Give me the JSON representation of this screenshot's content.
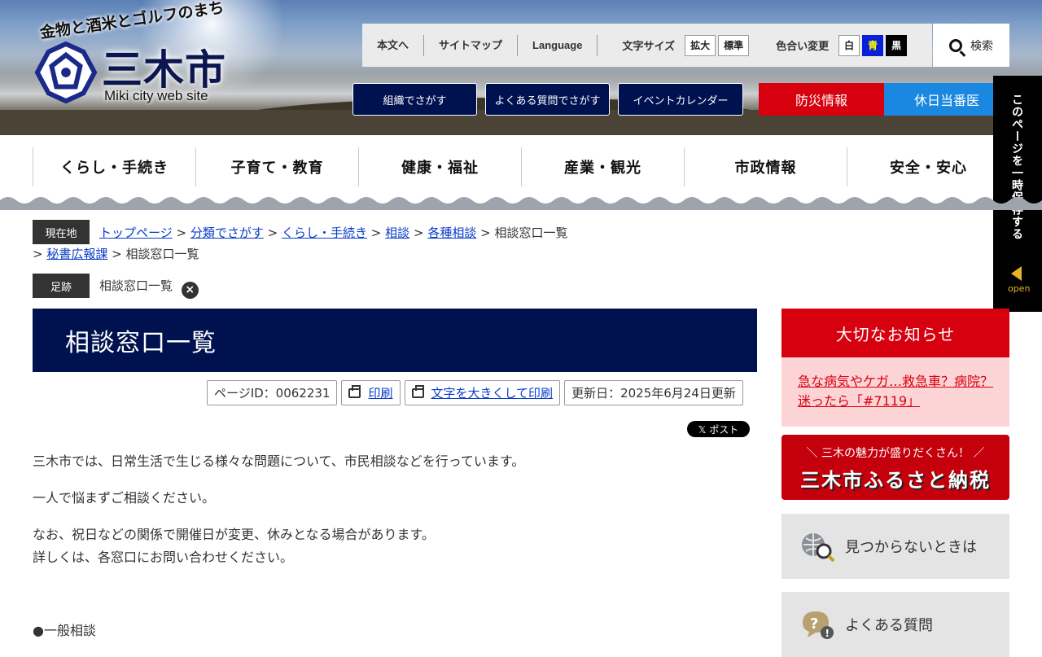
{
  "header": {
    "tagline": "金物と酒米とゴルフのまち",
    "city_name": "三木市",
    "site_subtitle": "Miki city web site",
    "util_links": [
      "本文へ",
      "サイトマップ",
      "Language"
    ],
    "font_size_label": "文字サイズ",
    "font_size_buttons": [
      "拡大",
      "標準"
    ],
    "color_label": "色合い変更",
    "color_buttons": [
      "白",
      "青",
      "黒"
    ],
    "search_label": "検索",
    "nav_buttons": [
      "組織でさがす",
      "よくある質問でさがす",
      "イベントカレンダー"
    ],
    "disaster_label": "防災情報",
    "holiday_label": "休日当番医"
  },
  "side_tab": {
    "text": "このページを一時保存する",
    "open_label": "open"
  },
  "global_nav": [
    "くらし・手続き",
    "子育て・教育",
    "健康・福祉",
    "産業・観光",
    "市政情報",
    "安全・安心"
  ],
  "breadcrumb": {
    "label": "現在地",
    "links1": [
      "トップページ",
      "分類でさがす",
      "くらし・手続き",
      "相談",
      "各種相談"
    ],
    "current1": "相談窓口一覧",
    "links2": [
      "秘書広報課"
    ],
    "current2": "相談窓口一覧",
    "sep": ">"
  },
  "history": {
    "label": "足跡",
    "item": "相談窓口一覧",
    "clear": "×"
  },
  "main": {
    "title": "相談窓口一覧",
    "page_id": "ページID：0062231",
    "print": "印刷",
    "print_large": "文字を大きくして印刷",
    "updated": "更新日：2025年6月24日更新",
    "post": "𝕏 ポスト",
    "para1": "三木市では、日常生活で生じる様々な問題について、市民相談などを行っています。",
    "para2": "一人で悩まずご相談ください。",
    "para3a": "なお、祝日などの関係で開催日が変更、休みとなる場合があります。",
    "para3b": "詳しくは、各窓口にお問い合わせください。",
    "section1": "●一般相談"
  },
  "sidebar": {
    "notice_title": "大切なお知らせ",
    "notice_link": "急な病気やケガ…救急車？病院？迷ったら「#7119」",
    "furusato_small": "＼ 三木の魅力が盛りだくさん！ ／",
    "furusato_big": "三木市ふるさと納税",
    "not_found": "見つからないときは",
    "faq": "よくある質問"
  },
  "colors": {
    "navy": "#001150",
    "red": "#d7000f",
    "blue": "#1a87e0",
    "notice_bg": "#fcd4d6"
  }
}
